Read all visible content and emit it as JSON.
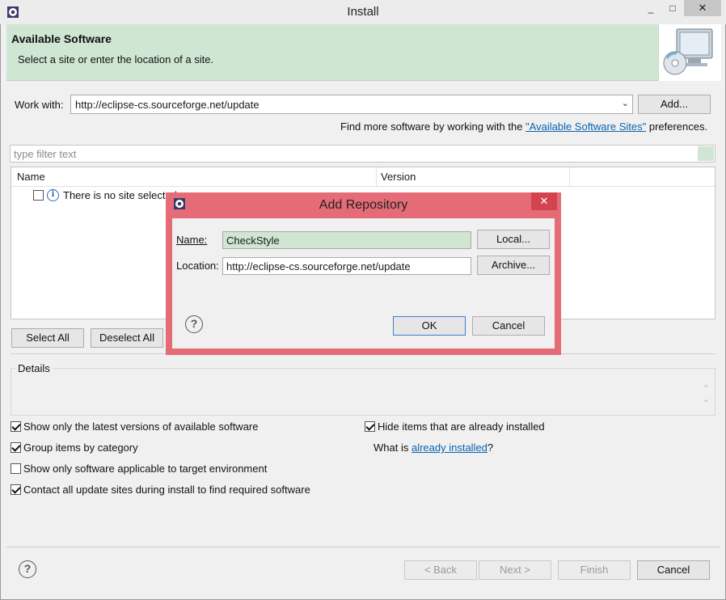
{
  "window": {
    "title": "Install",
    "min_glyph": "_",
    "max_glyph": "□",
    "close_glyph": "✕"
  },
  "banner": {
    "title": "Available Software",
    "subtitle": "Select a site or enter the location of a site."
  },
  "work_with": {
    "label": "Work with:",
    "value": "http://eclipse-cs.sourceforge.net/update",
    "add_button": "Add...",
    "find_more_prefix": "Find more software by working with the ",
    "find_more_link": "\"Available Software Sites\"",
    "find_more_suffix": " preferences."
  },
  "filter": {
    "placeholder": "type filter text"
  },
  "tree": {
    "columns": [
      "Name",
      "Version"
    ],
    "rows": [
      {
        "text": "There is no site selected."
      }
    ]
  },
  "selection_buttons": {
    "select_all": "Select All",
    "deselect_all": "Deselect All"
  },
  "details": {
    "label": "Details"
  },
  "options": {
    "show_latest": {
      "label": "Show only the latest versions of available software",
      "checked": true
    },
    "group_by_category": {
      "label": "Group items by category",
      "checked": true
    },
    "applicable_only": {
      "label": "Show only software applicable to target environment",
      "checked": false
    },
    "contact_sites": {
      "label": "Contact all update sites during install to find required software",
      "checked": true
    },
    "hide_installed": {
      "label": "Hide items that are already installed",
      "checked": true
    },
    "what_is_prefix": "What is ",
    "what_is_link": "already installed",
    "what_is_suffix": "?"
  },
  "footer": {
    "back": "< Back",
    "next": "Next >",
    "finish": "Finish",
    "cancel": "Cancel"
  },
  "dialog": {
    "title": "Add Repository",
    "close_glyph": "✕",
    "name_label": "Name:",
    "name_value": "CheckStyle",
    "location_label": "Location:",
    "location_value": "http://eclipse-cs.sourceforge.net/update",
    "local_button": "Local...",
    "archive_button": "Archive...",
    "ok_button": "OK",
    "cancel_button": "Cancel"
  },
  "colors": {
    "banner_bg": "#cfe6d2",
    "dialog_frame": "#e56b77",
    "link": "#0b63ad"
  },
  "icons": {
    "app": "eclipse-gear-icon",
    "help": "help-icon",
    "info": "info-icon"
  }
}
